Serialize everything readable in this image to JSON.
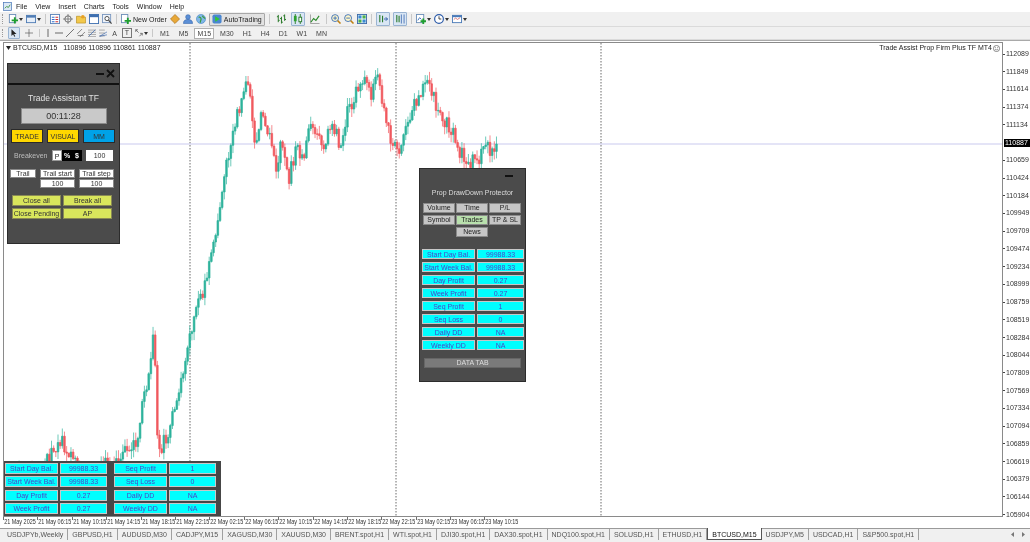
{
  "menu": [
    "File",
    "View",
    "Insert",
    "Charts",
    "Tools",
    "Window",
    "Help"
  ],
  "toolbar": {
    "new_order": "New Order",
    "auto_trading": {
      "label": "AutoTrading",
      "on": true
    },
    "chart_types": [
      {
        "kind": "bars",
        "selected": false
      },
      {
        "kind": "candles",
        "selected": true
      },
      {
        "kind": "line",
        "selected": false
      }
    ],
    "auto_scroll": {
      "on": true
    },
    "chart_shift": {
      "on": true
    }
  },
  "drawing_toolbar": {
    "cursors": [
      {
        "kind": "arrow",
        "selected": true
      },
      {
        "kind": "crosshair",
        "selected": false
      }
    ],
    "text_tools": [
      {
        "kind": "text",
        "glyph": "A"
      },
      {
        "kind": "label",
        "glyph": "T"
      }
    ],
    "timeframes": [
      {
        "label": "M1",
        "selected": false
      },
      {
        "label": "M5",
        "selected": false
      },
      {
        "label": "M15",
        "selected": true
      },
      {
        "label": "M30",
        "selected": false
      },
      {
        "label": "H1",
        "selected": false
      },
      {
        "label": "H4",
        "selected": false
      },
      {
        "label": "D1",
        "selected": false
      },
      {
        "label": "W1",
        "selected": false
      },
      {
        "label": "MN",
        "selected": false
      }
    ]
  },
  "chart": {
    "symbol": "BTCUSD,M15",
    "quotes": "110896 110896 110861 110887",
    "indicator_label": "Trade Assist Prop Firm Plus TF MT4",
    "price_scale": [
      {
        "label": "112089",
        "kind": "tick"
      },
      {
        "label": "111849",
        "kind": "tick"
      },
      {
        "label": "111614",
        "kind": "tick"
      },
      {
        "label": "111374",
        "kind": "tick"
      },
      {
        "label": "111134",
        "kind": "tick"
      },
      {
        "label": "110887",
        "kind": "current"
      },
      {
        "label": "110659",
        "kind": "tick"
      },
      {
        "label": "110424",
        "kind": "tick"
      },
      {
        "label": "110184",
        "kind": "tick"
      },
      {
        "label": "109949",
        "kind": "tick"
      },
      {
        "label": "109709",
        "kind": "tick"
      },
      {
        "label": "109474",
        "kind": "tick"
      },
      {
        "label": "109234",
        "kind": "tick"
      },
      {
        "label": "108999",
        "kind": "tick"
      },
      {
        "label": "108759",
        "kind": "tick"
      },
      {
        "label": "108519",
        "kind": "tick"
      },
      {
        "label": "108284",
        "kind": "tick"
      },
      {
        "label": "108044",
        "kind": "tick"
      },
      {
        "label": "107809",
        "kind": "tick"
      },
      {
        "label": "107569",
        "kind": "tick"
      },
      {
        "label": "107334",
        "kind": "tick"
      },
      {
        "label": "107094",
        "kind": "tick"
      },
      {
        "label": "106859",
        "kind": "tick"
      },
      {
        "label": "106619",
        "kind": "tick"
      },
      {
        "label": "106379",
        "kind": "tick"
      },
      {
        "label": "106144",
        "kind": "tick"
      },
      {
        "label": "105904",
        "kind": "tick"
      }
    ],
    "time_scale": [
      "21 May 2025",
      "21 May 06:15",
      "21 May 10:15",
      "21 May 14:15",
      "21 May 18:15",
      "21 May 22:15",
      "22 May 02:15",
      "22 May 06:15",
      "22 May 10:15",
      "22 May 14:15",
      "22 May 18:15",
      "22 May 22:15",
      "23 May 02:15",
      "23 May 06:15",
      "23 May 10:15"
    ]
  },
  "trade_assistant": {
    "title": "Trade Assistant TF",
    "timer": "00:11:28",
    "mode_buttons": [
      {
        "label": "TRADE",
        "color": "#ffd700"
      },
      {
        "label": "VISUAL",
        "color": "#ffd700"
      },
      {
        "label": "MM",
        "color": "#00a2e8"
      }
    ],
    "breakeven": {
      "label": "Breakeven",
      "modes": [
        {
          "label": "P",
          "selected": true
        },
        {
          "label": "%",
          "selected": false
        },
        {
          "label": "$",
          "selected": false
        }
      ],
      "value": "100"
    },
    "trail": {
      "label": "Trail",
      "start_label": "Trail start",
      "start_value": "100",
      "step_label": "Trail step",
      "step_value": "100"
    },
    "actions": [
      "Close all",
      "Break all",
      "Close Pending",
      "AP"
    ]
  },
  "protector": {
    "title": "Prop DrawDown Protector",
    "tabs": [
      {
        "label": "Volume",
        "selected": false
      },
      {
        "label": "Time",
        "selected": false
      },
      {
        "label": "P/L",
        "selected": false
      },
      {
        "label": "Symbol",
        "selected": false
      },
      {
        "label": "Trades",
        "selected": true
      },
      {
        "label": "TP & SL",
        "selected": false
      },
      {
        "label": "News",
        "selected": false
      }
    ],
    "rows": [
      {
        "label": "Start Day Bal.",
        "value": "99988.33"
      },
      {
        "label": "Start Week Bal.",
        "value": "99988.33"
      },
      {
        "label": "Day Profit",
        "value": "0.27"
      },
      {
        "label": "Week Profit",
        "value": "0.27"
      },
      {
        "label": "Seq Profit",
        "value": "1"
      },
      {
        "label": "Seq Loss",
        "value": "0"
      },
      {
        "label": "Daily DD",
        "value": "NA"
      },
      {
        "label": "Weekly DD",
        "value": "NA"
      }
    ],
    "data_tab": "DATA TAB"
  },
  "summary_table": {
    "groups": [
      {
        "rows": [
          {
            "label": "Start Day Bal.",
            "value": "99988.33"
          },
          {
            "label": "Start Week Bal.",
            "value": "99988.33"
          },
          {
            "label": "Day Profit",
            "value": "0.27"
          },
          {
            "label": "Week Profit",
            "value": "0.27"
          }
        ]
      },
      {
        "rows": [
          {
            "label": "Seq Profit",
            "value": "1"
          },
          {
            "label": "Seq Loss",
            "value": "0"
          },
          {
            "label": "Daily DD",
            "value": "NA"
          },
          {
            "label": "Weekly DD",
            "value": "NA"
          }
        ]
      }
    ]
  },
  "chart_tabs": [
    {
      "label": "USDJPYb,Weekly",
      "selected": false
    },
    {
      "label": "GBPUSD,H1",
      "selected": false
    },
    {
      "label": "AUDUSD,M30",
      "selected": false
    },
    {
      "label": "CADJPY,M15",
      "selected": false
    },
    {
      "label": "XAGUSD,M30",
      "selected": false
    },
    {
      "label": "XAUUSD,M30",
      "selected": false
    },
    {
      "label": "BRENT.spot,H1",
      "selected": false
    },
    {
      "label": "WTI.spot,H1",
      "selected": false
    },
    {
      "label": "DJI30.spot,H1",
      "selected": false
    },
    {
      "label": "DAX30.spot,H1",
      "selected": false
    },
    {
      "label": "NDQ100.spot,H1",
      "selected": false
    },
    {
      "label": "SOLUSD,H1",
      "selected": false
    },
    {
      "label": "ETHUSD,H1",
      "selected": false
    },
    {
      "label": "BTCUSD,M15",
      "selected": true
    },
    {
      "label": "USDJPY,M5",
      "selected": false
    },
    {
      "label": "USDCAD,H1",
      "selected": false
    },
    {
      "label": "S&P500.spot,H1",
      "selected": false
    }
  ]
}
